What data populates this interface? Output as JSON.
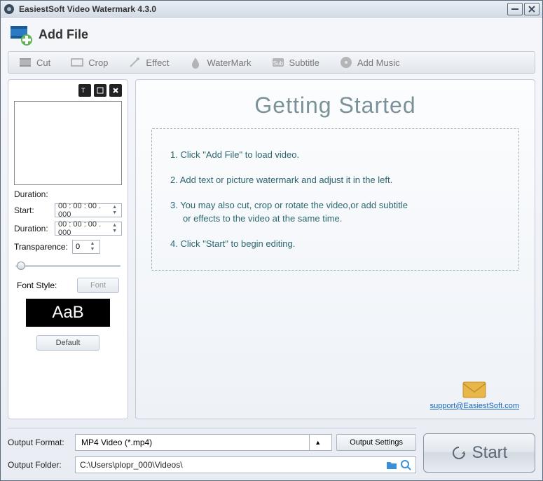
{
  "window": {
    "title": "EasiestSoft Video Watermark 4.3.0"
  },
  "add_file": {
    "label": "Add File"
  },
  "toolbar": {
    "cut": "Cut",
    "crop": "Crop",
    "effect": "Effect",
    "watermark": "WaterMark",
    "subtitle": "Subtitle",
    "addmusic": "Add Music"
  },
  "left": {
    "duration_heading": "Duration:",
    "start_label": "Start:",
    "start_value": "00 : 00 : 00 . 000",
    "duration_label": "Duration:",
    "duration_value": "00 : 00 : 00 . 000",
    "transparency_label": "Transparence:",
    "transparency_value": "0",
    "fontstyle_label": "Font Style:",
    "font_button": "Font",
    "sample_text": "AaB",
    "default_button": "Default"
  },
  "right": {
    "title": "Getting Started",
    "step1": "1. Click \"Add File\" to load video.",
    "step2": "2. Add text or picture watermark and adjust it in the left.",
    "step3a": "3. You may also cut, crop or rotate the video,or add subtitle",
    "step3b": "or effects to the video at the same time.",
    "step4": "4. Click \"Start\" to begin editing.",
    "support_email": "support@EasiestSoft.com"
  },
  "bottom": {
    "format_label": "Output Format:",
    "format_value": "MP4 Video (*.mp4)",
    "settings_button": "Output Settings",
    "folder_label": "Output Folder:",
    "folder_value": "C:\\Users\\plopr_000\\Videos\\",
    "start_button": "Start"
  }
}
